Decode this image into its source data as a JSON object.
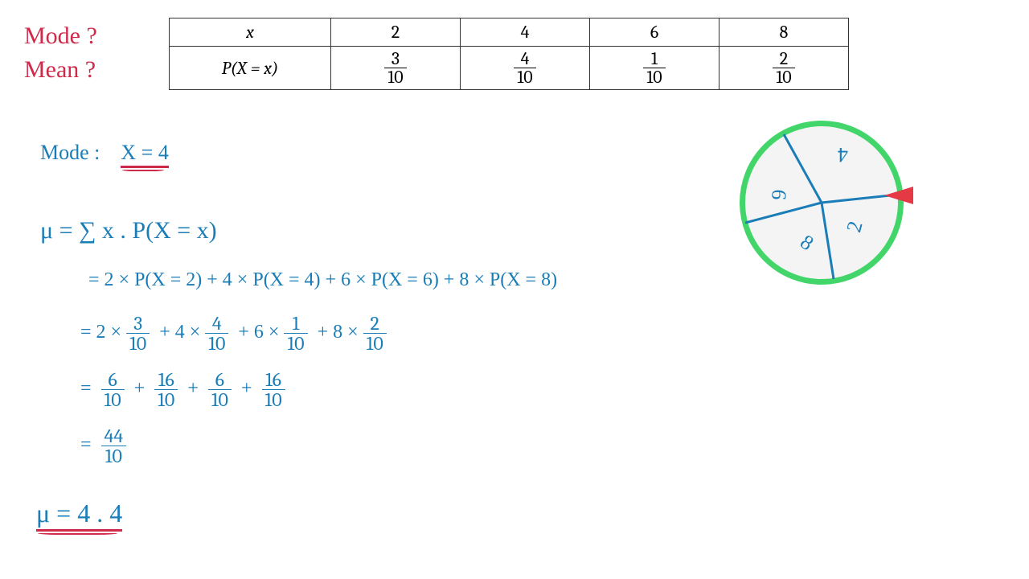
{
  "prompt": {
    "mode": "Mode ?",
    "mean": "Mean ?"
  },
  "table": {
    "row1_label": "x",
    "row2_label": "P(X = x)",
    "x": [
      "2",
      "4",
      "6",
      "8"
    ],
    "p_num": [
      "3",
      "4",
      "1",
      "2"
    ],
    "p_den": [
      "10",
      "10",
      "10",
      "10"
    ]
  },
  "work": {
    "mode_label": "Mode :",
    "mode_value": "X = 4",
    "mu_formula": "μ  =  ∑ x . P(X = x)",
    "step1": "= 2 × P(X = 2)  +  4 × P(X = 4)  +  6 × P(X = 6) + 8 × P(X = 8)",
    "step2_a": "= 2 ×",
    "step2_b": "+  4 ×",
    "step2_c": "+  6 ×",
    "step2_d": "+  8 ×",
    "f2a_n": "3",
    "f2a_d": "10",
    "f2b_n": "4",
    "f2b_d": "10",
    "f2c_n": "1",
    "f2c_d": "10",
    "f2d_n": "2",
    "f2d_d": "10",
    "step3_eq": "=",
    "f3a_n": "6",
    "f3a_d": "10",
    "plus": "+",
    "f3b_n": "16",
    "f3b_d": "10",
    "f3c_n": "6",
    "f3c_d": "10",
    "f3d_n": "16",
    "f3d_d": "10",
    "f4_n": "44",
    "f4_d": "10",
    "result": "μ  =  4 . 4"
  },
  "spinner": {
    "a": "4",
    "b": "6",
    "c": "8",
    "d": "2"
  },
  "chart_data": {
    "type": "table",
    "title": "Discrete probability distribution — mode and mean (expected value)",
    "x": [
      2,
      4,
      6,
      8
    ],
    "p": [
      0.3,
      0.4,
      0.1,
      0.2
    ],
    "mode": 4,
    "mean": 4.4,
    "working": {
      "terms": [
        "2×3/10",
        "4×4/10",
        "6×1/10",
        "8×2/10"
      ],
      "partial": [
        "6/10",
        "16/10",
        "6/10",
        "16/10"
      ],
      "sum": "44/10"
    },
    "spinner_sectors": [
      {
        "label": 4,
        "weight": 4
      },
      {
        "label": 6,
        "weight": 1
      },
      {
        "label": 8,
        "weight": 2
      },
      {
        "label": 2,
        "weight": 3
      }
    ]
  }
}
